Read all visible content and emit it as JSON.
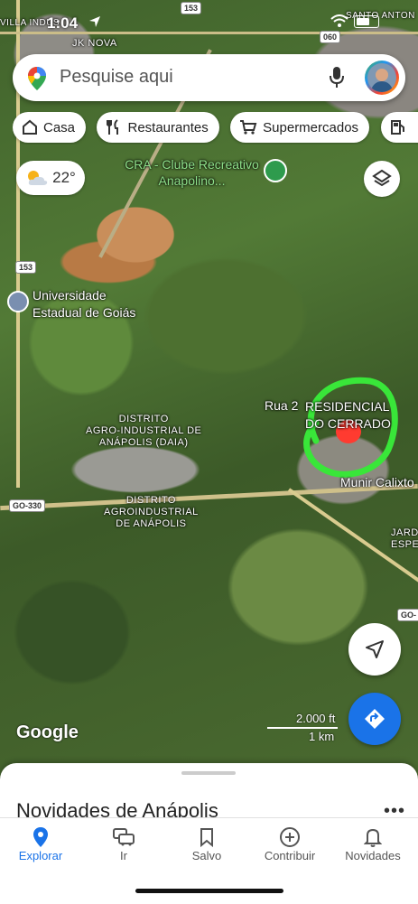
{
  "status": {
    "time": "1:04"
  },
  "search": {
    "placeholder": "Pesquise aqui"
  },
  "chips": [
    {
      "label": "Casa",
      "icon": "home-icon"
    },
    {
      "label": "Restaurantes",
      "icon": "restaurant-icon"
    },
    {
      "label": "Supermercados",
      "icon": "cart-icon"
    }
  ],
  "weather": {
    "temp": "22°",
    "icon": "partly-cloudy-icon"
  },
  "map_labels": {
    "clube": "CRA - Clube Recreativo Anapolino...",
    "university_line1": "Universidade",
    "university_line2": "Estadual de Goiás",
    "daia_line1": "DISTRITO",
    "daia_line2": "AGRO-INDUSTRIAL DE",
    "daia_line3": "ANÁPOLIS (DAIA)",
    "distrito2_line1": "DISTRITO",
    "distrito2_line2": "AGROINDUSTRIAL",
    "distrito2_line3": "DE ANÁPOLIS",
    "rua": "Rua 2",
    "residencial_line1": "RESIDENCIAL",
    "residencial_line2": "DO CERRADO",
    "munir": "Munir Calixto",
    "jardim_line1": "JARDI",
    "jardim_line2": "ESPERA",
    "santo_antonio": "SANTO ANTON",
    "jk_nova": "JK NOVA",
    "villa_industrial": "VILLA INDUS",
    "route_153_top": "153",
    "route_153_left": "153",
    "route_060": "060",
    "route_go330": "GO-330",
    "route_go_right": "GO-"
  },
  "scale": {
    "ft": "2.000 ft",
    "km": "1 km"
  },
  "attribution": "Google",
  "sheet": {
    "title": "Novidades de Anápolis",
    "more": "•••"
  },
  "nav": [
    {
      "label": "Explorar",
      "icon": "explore-pin-icon",
      "active": true
    },
    {
      "label": "Ir",
      "icon": "car-icon",
      "active": false
    },
    {
      "label": "Salvo",
      "icon": "bookmark-icon",
      "active": false
    },
    {
      "label": "Contribuir",
      "icon": "add-circle-icon",
      "active": false
    },
    {
      "label": "Novidades",
      "icon": "bell-icon",
      "active": false
    }
  ],
  "colors": {
    "accent": "#1a73e8",
    "annotation_circle": "#39e639",
    "annotation_dot": "#ff3b30"
  }
}
